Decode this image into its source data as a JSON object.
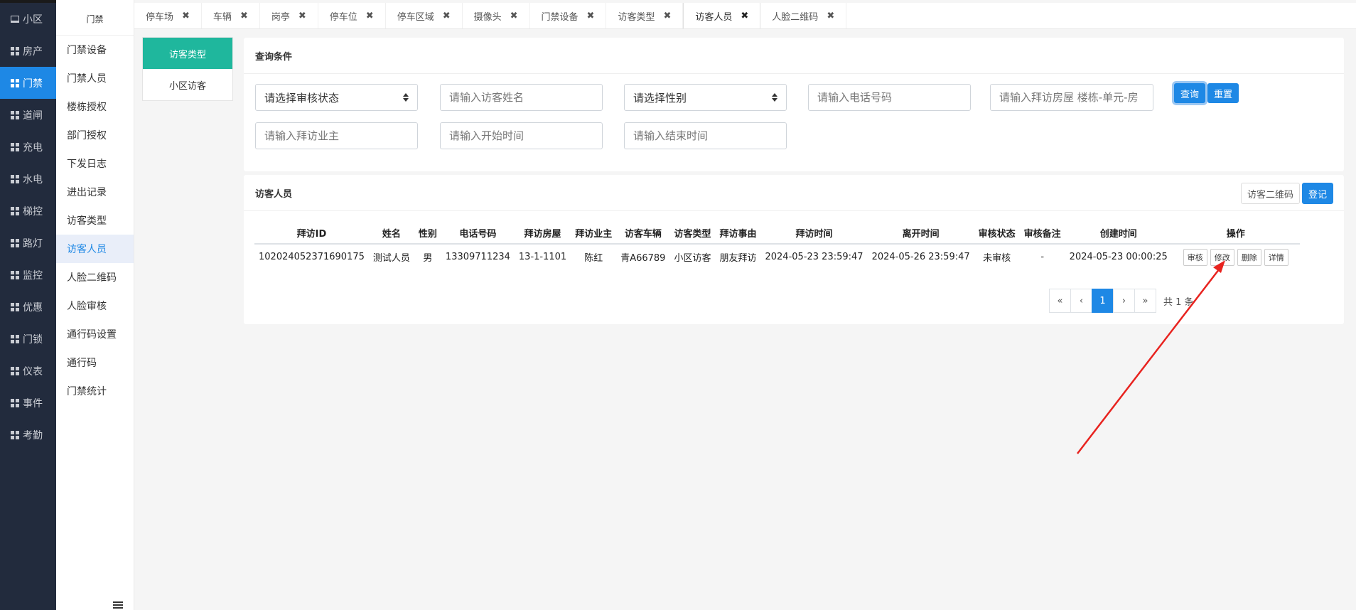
{
  "sidebar": {
    "items": [
      {
        "label": "小区",
        "icon": "laptop-icon"
      },
      {
        "label": "房产",
        "icon": "grid-icon"
      },
      {
        "label": "门禁",
        "icon": "grid-icon",
        "active": true
      },
      {
        "label": "道闸",
        "icon": "grid-icon"
      },
      {
        "label": "充电",
        "icon": "grid-icon"
      },
      {
        "label": "水电",
        "icon": "grid-icon"
      },
      {
        "label": "梯控",
        "icon": "grid-icon"
      },
      {
        "label": "路灯",
        "icon": "grid-icon"
      },
      {
        "label": "监控",
        "icon": "grid-icon"
      },
      {
        "label": "优惠",
        "icon": "grid-icon"
      },
      {
        "label": "门锁",
        "icon": "grid-icon"
      },
      {
        "label": "仪表",
        "icon": "grid-icon"
      },
      {
        "label": "事件",
        "icon": "grid-icon"
      },
      {
        "label": "考勤",
        "icon": "grid-icon"
      }
    ]
  },
  "submenu": {
    "title": "门禁",
    "items": [
      "门禁设备",
      "门禁人员",
      "楼栋授权",
      "部门授权",
      "下发日志",
      "进出记录",
      "访客类型",
      "访客人员",
      "人脸二维码",
      "人脸审核",
      "通行码设置",
      "通行码",
      "门禁统计"
    ],
    "active_index": 7
  },
  "tabs": [
    {
      "label": "停车场"
    },
    {
      "label": "车辆"
    },
    {
      "label": "岗亭"
    },
    {
      "label": "停车位"
    },
    {
      "label": "停车区域"
    },
    {
      "label": "摄像头"
    },
    {
      "label": "门禁设备"
    },
    {
      "label": "访客类型"
    },
    {
      "label": "访客人员",
      "active": true
    },
    {
      "label": "人脸二维码"
    }
  ],
  "type_menu": {
    "items": [
      "访客类型",
      "小区访客"
    ],
    "active_index": 0
  },
  "query": {
    "title": "查询条件",
    "audit_status_placeholder": "请选择审核状态",
    "name_placeholder": "请输入访客姓名",
    "gender_placeholder": "请选择性别",
    "phone_placeholder": "请输入电话号码",
    "room_placeholder": "请输入拜访房屋 楼栋-单元-房",
    "owner_placeholder": "请输入拜访业主",
    "start_placeholder": "请输入开始时间",
    "end_placeholder": "请输入结束时间",
    "search_label": "查询",
    "reset_label": "重置"
  },
  "list": {
    "title": "访客人员",
    "qrcode_label": "访客二维码",
    "register_label": "登记",
    "columns": [
      "拜访ID",
      "姓名",
      "性别",
      "电话号码",
      "拜访房屋",
      "拜访业主",
      "访客车辆",
      "访客类型",
      "拜访事由",
      "拜访时间",
      "离开时间",
      "审核状态",
      "审核备注",
      "创建时间",
      "操作"
    ],
    "rows": [
      {
        "cells": [
          "102024052371690175",
          "测试人员",
          "男",
          "13309711234",
          "13-1-1101",
          "陈红",
          "青A66789",
          "小区访客",
          "朋友拜访",
          "2024-05-23 23:59:47",
          "2024-05-26 23:59:47",
          "未审核",
          "-",
          "2024-05-23 00:00:25"
        ],
        "actions": [
          "审核",
          "修改",
          "删除",
          "详情"
        ]
      }
    ],
    "pager": {
      "first": "«",
      "prev": "‹",
      "current": "1",
      "next": "›",
      "last": "»",
      "total": "共 1 条"
    }
  }
}
